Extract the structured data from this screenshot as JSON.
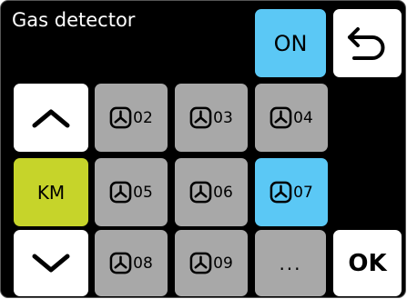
{
  "title": "Gas detector",
  "buttons": {
    "on": "ON",
    "km": "KM",
    "ok": "OK",
    "more": "..."
  },
  "devices": [
    {
      "label": "02",
      "active": false
    },
    {
      "label": "03",
      "active": false
    },
    {
      "label": "04",
      "active": false
    },
    {
      "label": "05",
      "active": false
    },
    {
      "label": "06",
      "active": false
    },
    {
      "label": "07",
      "active": true
    },
    {
      "label": "08",
      "active": false
    },
    {
      "label": "09",
      "active": false
    }
  ],
  "colors": {
    "background": "#000000",
    "active": "#5bc8f5",
    "inactive": "#a8a8a8",
    "km": "#c6d42a",
    "button": "#ffffff"
  },
  "icons": {
    "device": "fan-icon",
    "back": "back-arrow-icon",
    "up": "chevron-up-icon",
    "down": "chevron-down-icon"
  }
}
